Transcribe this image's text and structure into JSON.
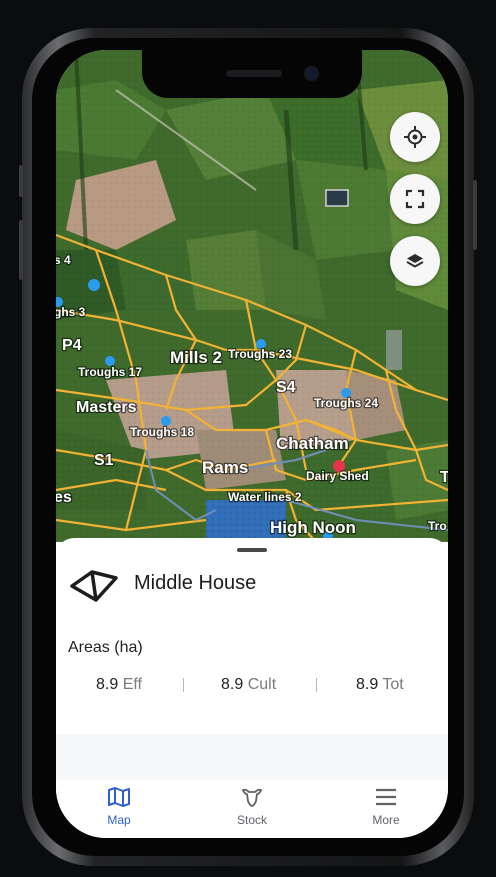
{
  "map": {
    "labels": {
      "l_s4top": "s 4",
      "l_troughs3": "ghs 3",
      "l_p4": "P4",
      "l_mills2": "Mills 2",
      "l_troughs23": "Troughs 23",
      "l_troughs17": "Troughs 17",
      "l_s4": "S4",
      "l_masters": "Masters",
      "l_troughs24": "Troughs 24",
      "l_troughs18": "Troughs 18",
      "l_chatham": "Chatham",
      "l_s1": "S1",
      "l_rams": "Rams",
      "l_dairyshed": "Dairy Shed",
      "l_t": "T",
      "l_es": "es",
      "l_waterlines2": "Water lines 2",
      "l_highnoon": "High Noon",
      "l_tro": "Tro"
    },
    "buttons": {
      "locate_icon": "crosshair-icon",
      "fullscreen_icon": "fullscreen-icon",
      "layers_icon": "layers-icon"
    }
  },
  "sheet": {
    "paddock_name": "Middle House",
    "areas_label": "Areas (ha)",
    "areas": [
      {
        "value": "8.9",
        "unit": "Eff"
      },
      {
        "value": "8.9",
        "unit": "Cult"
      },
      {
        "value": "8.9",
        "unit": "Tot"
      }
    ]
  },
  "tabs": [
    {
      "label": "Map",
      "icon": "map-icon",
      "active": true
    },
    {
      "label": "Stock",
      "icon": "stock-icon",
      "active": false
    },
    {
      "label": "More",
      "icon": "menu-icon",
      "active": false
    }
  ],
  "colors": {
    "accent": "#2f5fd0",
    "boundary": "#f2b233",
    "trough": "#2b9bf0",
    "shed": "#e8334a",
    "inactive_tab": "#5f6368"
  }
}
